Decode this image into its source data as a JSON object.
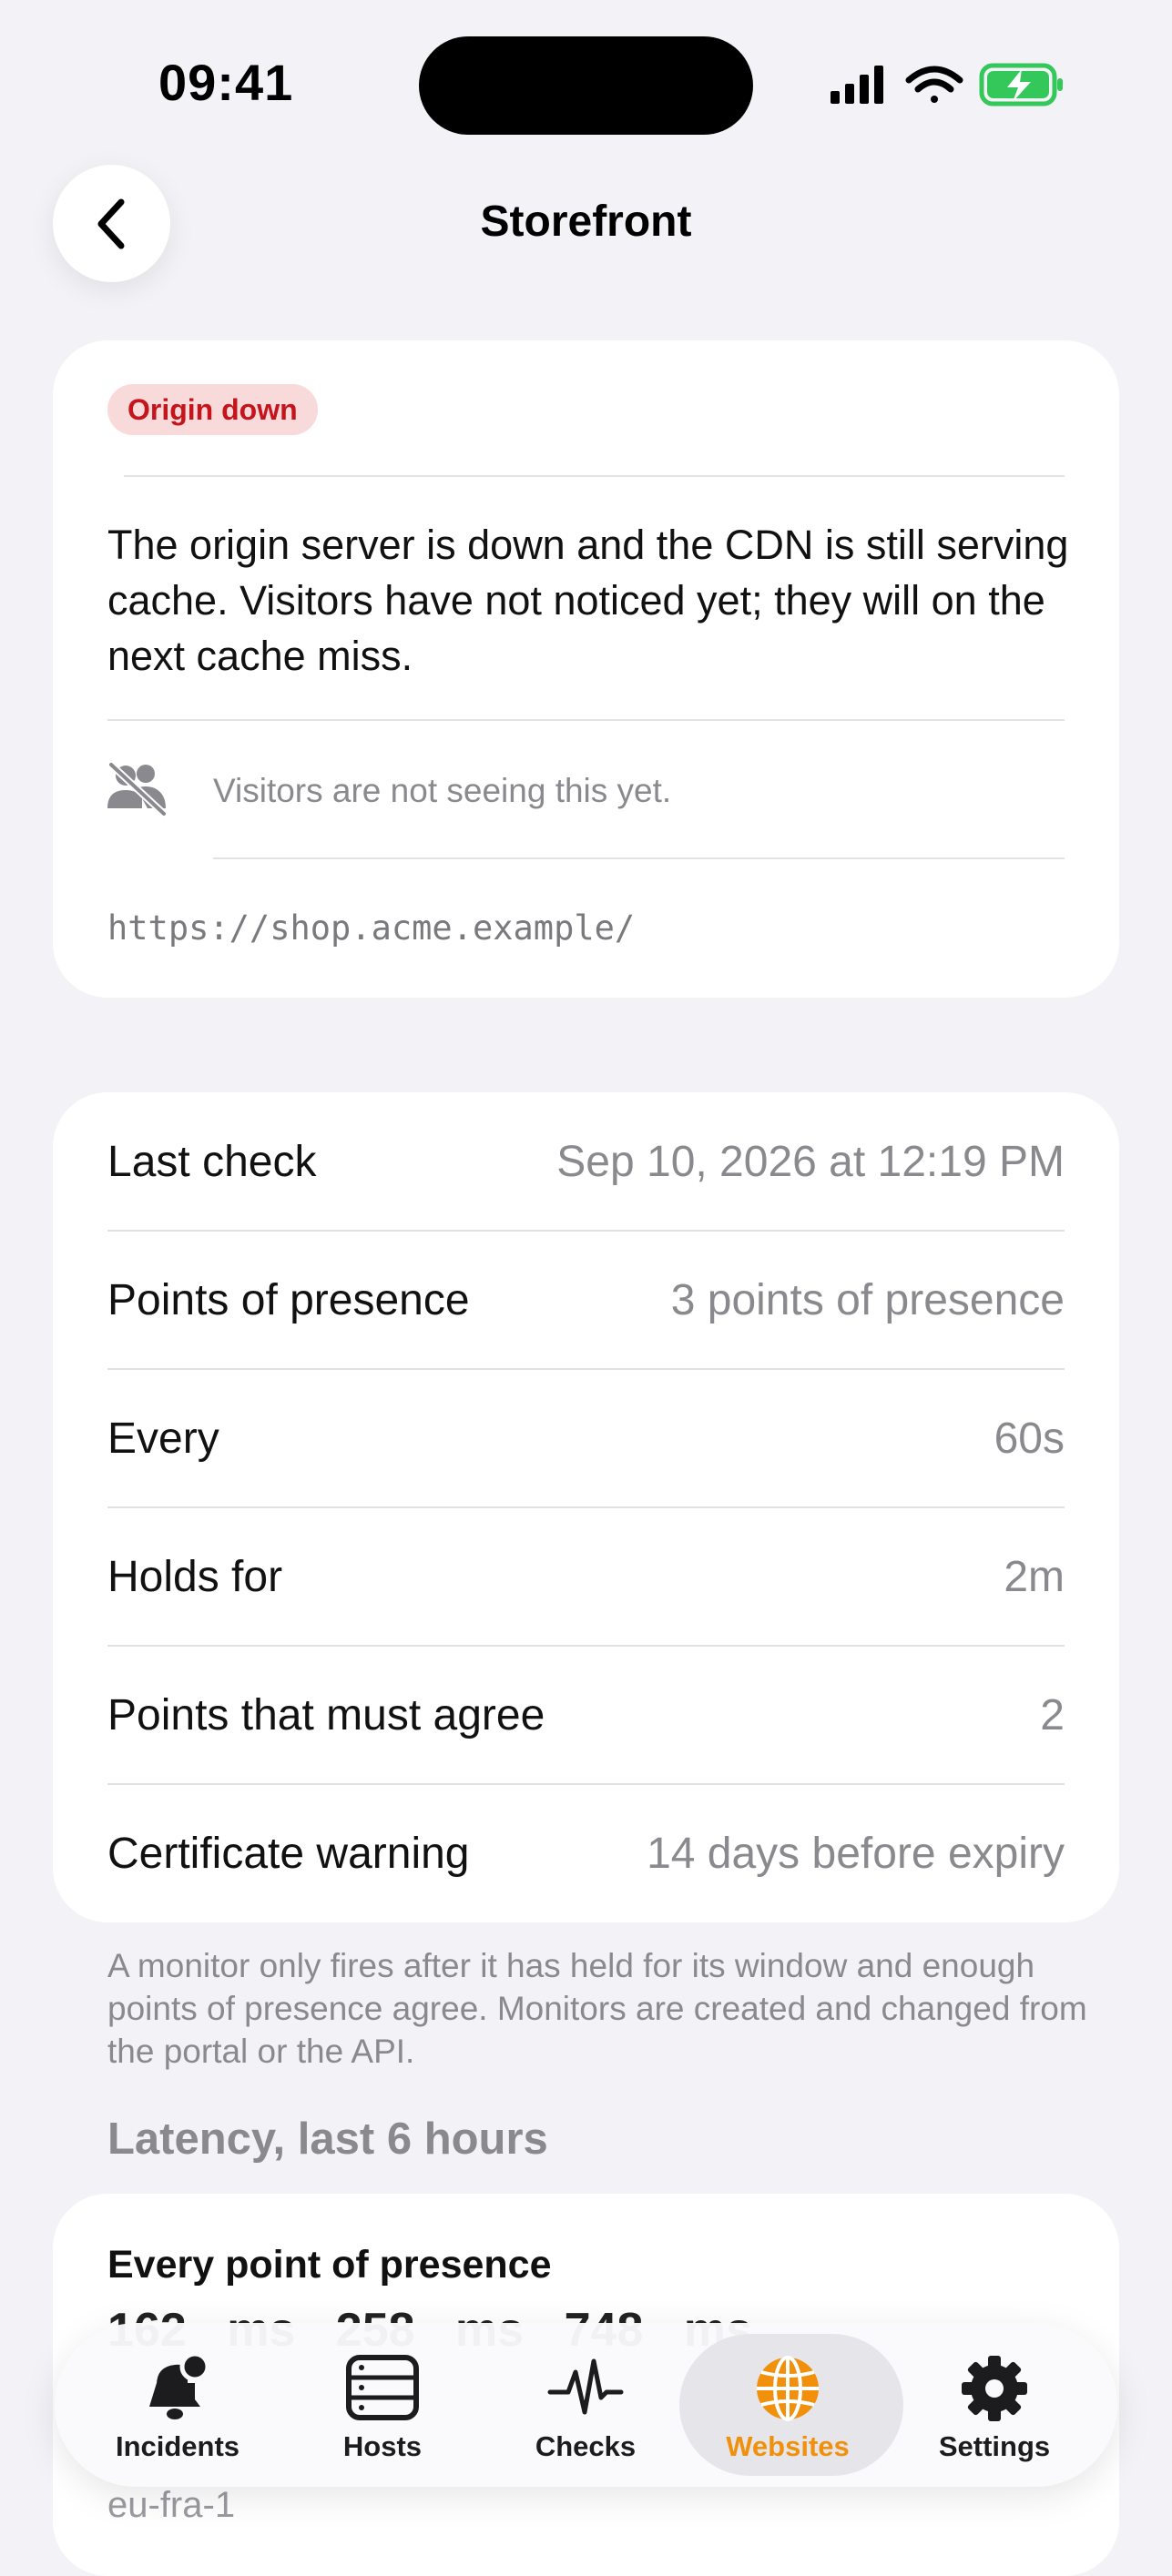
{
  "status_bar": {
    "time": "09:41"
  },
  "nav": {
    "title": "Storefront"
  },
  "incident": {
    "badge": "Origin down",
    "badge_color": "#c4141c",
    "description": "The origin server is down and the CDN is still serving cache. Visitors have not noticed yet; they will on the next cache miss.",
    "visitor_note": "Visitors are not seeing this yet.",
    "url": "https://shop.acme.example/"
  },
  "details": [
    {
      "label": "Last check",
      "value": "Sep 10, 2026 at 12:19 PM"
    },
    {
      "label": "Points of presence",
      "value": "3 points of presence"
    },
    {
      "label": "Every",
      "value": "60s"
    },
    {
      "label": "Holds for",
      "value": "2m"
    },
    {
      "label": "Points that must agree",
      "value": "2"
    },
    {
      "label": "Certificate warning",
      "value": "14 days before expiry"
    }
  ],
  "footnote": "A monitor only fires after it has held for its window and enough points of presence agree. Monitors are created and changed from the portal or the API.",
  "latency": {
    "section_title": "Latency, last 6 hours",
    "card_title": "Every point of presence",
    "values": "162 ms 258 ms 748 ms",
    "pop_label": "eu-fra-1"
  },
  "tabbar": {
    "accent": "#f0900c",
    "tabs": [
      {
        "label": "Incidents",
        "icon": "bell-badge-icon"
      },
      {
        "label": "Hosts",
        "icon": "server-icon"
      },
      {
        "label": "Checks",
        "icon": "waveform-icon"
      },
      {
        "label": "Websites",
        "icon": "globe-icon",
        "selected": true
      },
      {
        "label": "Settings",
        "icon": "gear-icon"
      }
    ]
  }
}
